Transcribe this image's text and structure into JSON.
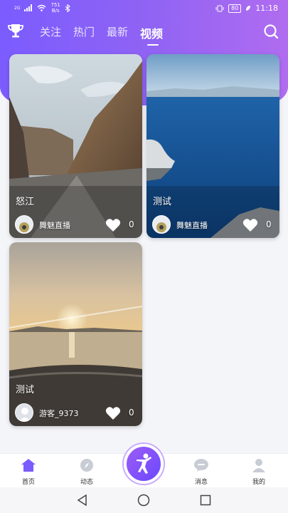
{
  "status": {
    "network": "2G",
    "speed_value": "751",
    "speed_unit": "B/s",
    "battery": "80",
    "time": "11:18"
  },
  "header": {
    "tabs": [
      {
        "label": "关注"
      },
      {
        "label": "热门"
      },
      {
        "label": "最新"
      },
      {
        "label": "视频"
      }
    ],
    "active_tab": "视频"
  },
  "videos": [
    {
      "title": "怒江",
      "author": "舞魅直播",
      "likes": "0"
    },
    {
      "title": "测试",
      "author": "舞魅直播",
      "likes": "0"
    },
    {
      "title": "测试",
      "author": "游客_9373",
      "likes": "0"
    }
  ],
  "bottom_nav": {
    "items": [
      {
        "label": "首页",
        "icon": "home-icon"
      },
      {
        "label": "动态",
        "icon": "compass-icon"
      },
      {
        "label": "消息",
        "icon": "message-icon"
      },
      {
        "label": "我的",
        "icon": "user-icon"
      }
    ],
    "center_icon": "dancer-icon",
    "accent": "#7b5cff"
  }
}
